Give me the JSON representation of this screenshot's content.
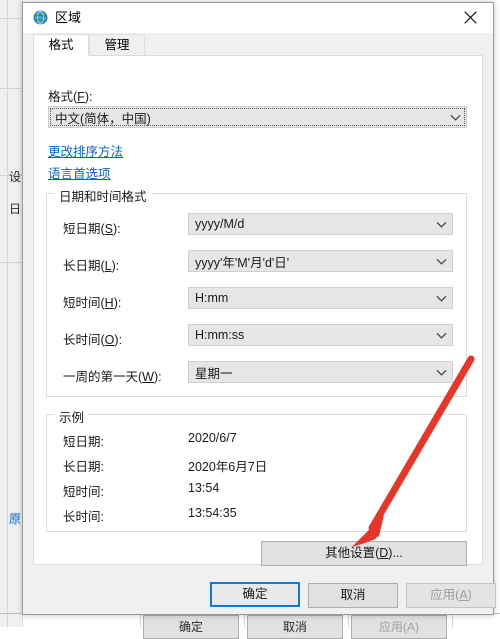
{
  "background_window": {
    "buttons": [
      {
        "label": "确定"
      },
      {
        "label": "取消"
      },
      {
        "label": "应用(A)"
      }
    ],
    "fragments": [
      {
        "text": "设"
      },
      {
        "text": "日"
      },
      {
        "text": "原"
      }
    ]
  },
  "dialog": {
    "title": "区域",
    "icon": "globe-icon",
    "close_label": "×",
    "tabs": [
      {
        "label": "格式",
        "active": true
      },
      {
        "label": "管理",
        "active": false
      }
    ],
    "format_section": {
      "label": "格式(F):",
      "label_prefix": "格式(",
      "label_accel": "F",
      "label_suffix": "):",
      "value": "中文(简体，中国)",
      "chevron": "chevron-down-icon",
      "links": [
        {
          "label": "更改排序方法"
        },
        {
          "label": "语言首选项"
        }
      ]
    },
    "datetime_group": {
      "title": "日期和时间格式",
      "rows": [
        {
          "label_prefix": "短日期(",
          "accel": "S",
          "label_suffix": "):",
          "value": "yyyy/M/d"
        },
        {
          "label_prefix": "长日期(",
          "accel": "L",
          "label_suffix": "):",
          "value": "yyyy'年'M'月'd'日'"
        },
        {
          "label_prefix": "短时间(",
          "accel": "H",
          "label_suffix": "):",
          "value": "H:mm"
        },
        {
          "label_prefix": "长时间(",
          "accel": "O",
          "label_suffix": "):",
          "value": "H:mm:ss"
        },
        {
          "label_prefix": "一周的第一天(",
          "accel": "W",
          "label_suffix": "):",
          "value": "星期一"
        }
      ]
    },
    "sample_group": {
      "title": "示例",
      "rows": [
        {
          "label": "短日期:",
          "value": "2020/6/7"
        },
        {
          "label": "长日期:",
          "value": "2020年6月7日"
        },
        {
          "label": "短时间:",
          "value": "13:54"
        },
        {
          "label": "长时间:",
          "value": "13:54:35"
        }
      ]
    },
    "additional_settings_button": {
      "label_prefix": "其他设置(",
      "accel": "D",
      "label_suffix": ")..."
    },
    "footer_buttons": [
      {
        "label": "确定",
        "state": "default"
      },
      {
        "label": "取消",
        "state": "normal"
      },
      {
        "label_prefix": "应用(",
        "accel": "A",
        "label_suffix": ")",
        "state": "disabled"
      }
    ]
  },
  "annotation": {
    "type": "arrow",
    "color": "#e8352a",
    "points_to": "其他设置(D)..."
  }
}
